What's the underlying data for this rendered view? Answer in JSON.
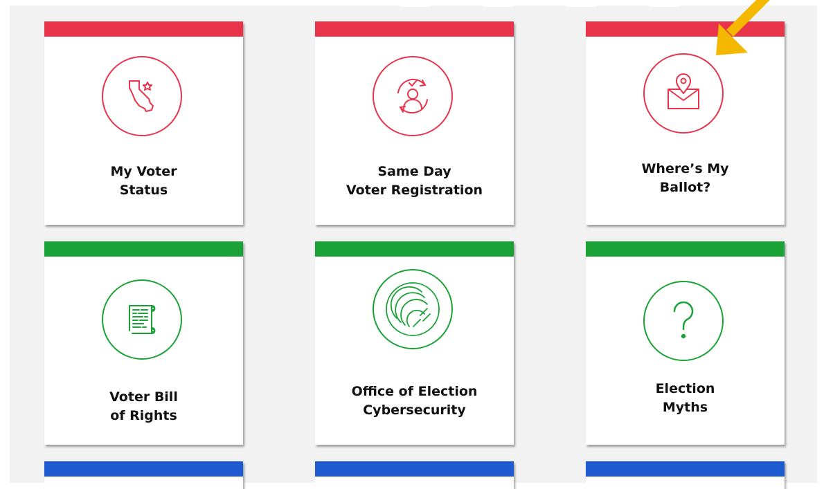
{
  "colors": {
    "red": "#e8334a",
    "green": "#1aa237",
    "blue": "#1f5ad0",
    "arrow": "#f5b800"
  },
  "cards": [
    {
      "label": "My Voter\nStatus",
      "icon": "california-map-icon"
    },
    {
      "label": "Same Day\nVoter Registration",
      "icon": "voter-registration-icon"
    },
    {
      "label": "Where’s My\nBallot?",
      "icon": "ballot-location-icon"
    },
    {
      "label": "Voter Bill\nof Rights",
      "icon": "scroll-icon"
    },
    {
      "label": "Office of Election\nCybersecurity",
      "icon": "fingerprint-icon"
    },
    {
      "label": "Election\nMyths",
      "icon": "question-mark-icon"
    }
  ]
}
